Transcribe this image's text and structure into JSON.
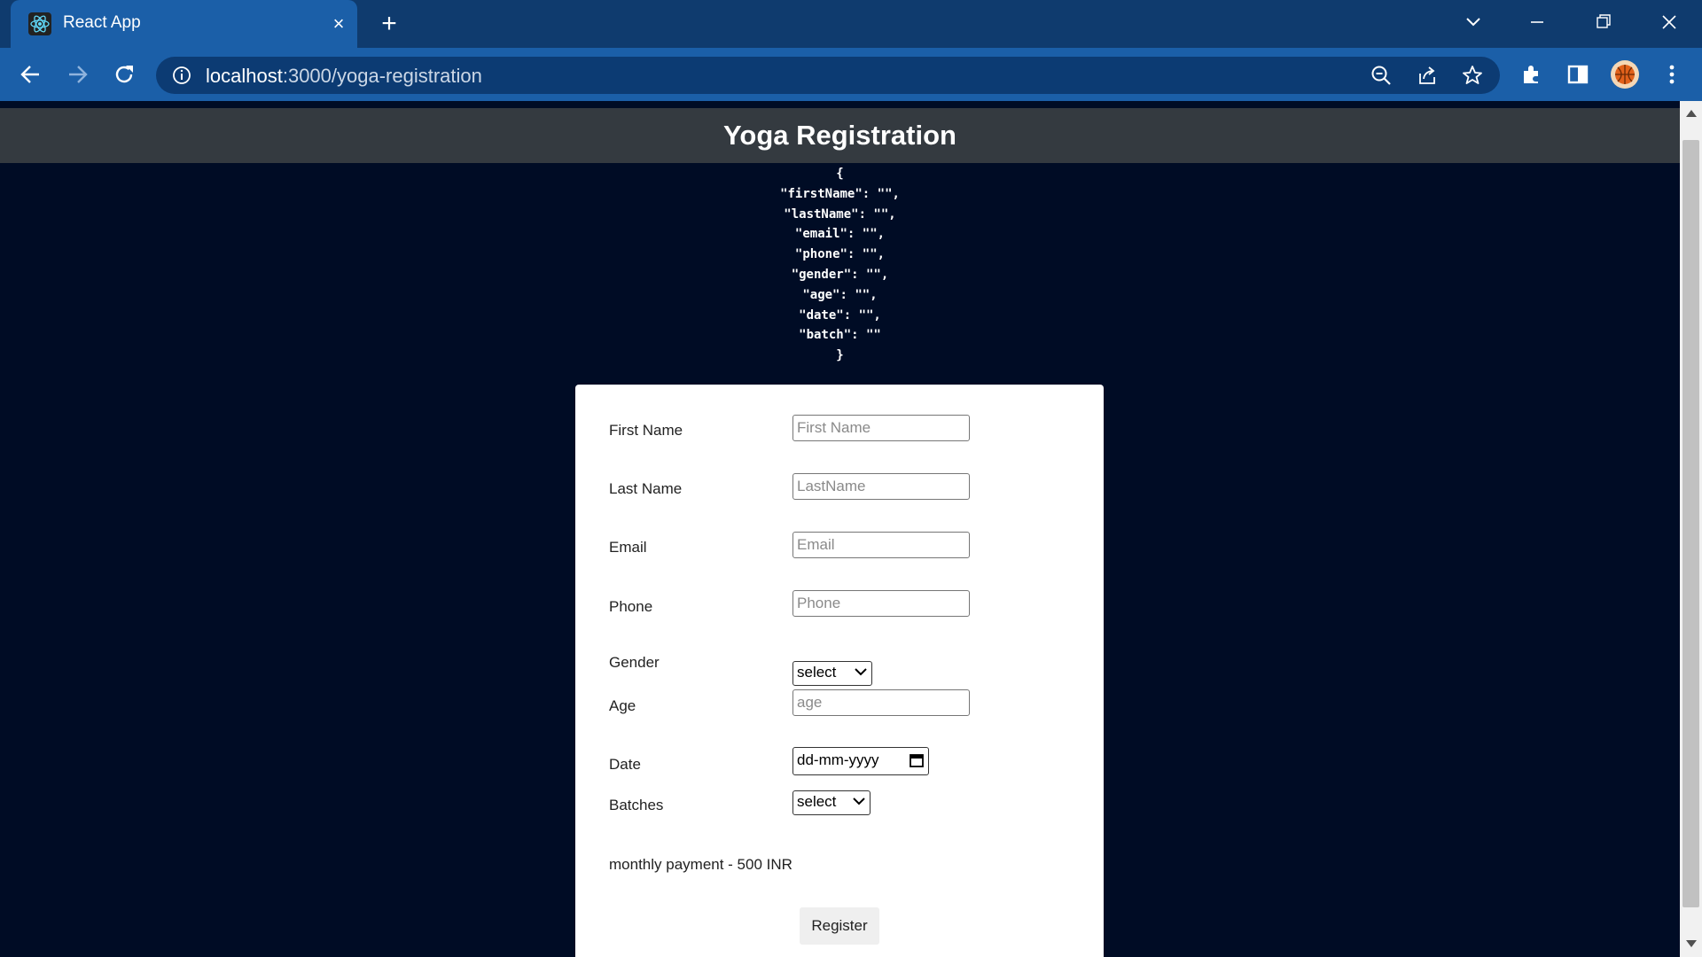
{
  "browser": {
    "tab_title": "React App",
    "tab_close": "×",
    "new_tab": "+",
    "url_host": "localhost",
    "url_path": ":3000/yoga-registration",
    "icons": {
      "favicon": "react-logo-icon",
      "back": "back-arrow-icon",
      "forward": "forward-arrow-icon",
      "reload": "reload-icon",
      "info": "info-icon",
      "zoom": "zoom-out-icon",
      "share": "share-icon",
      "bookmark": "star-icon",
      "extensions": "puzzle-icon",
      "sidepanel": "side-panel-icon",
      "profile": "avatar",
      "menu": "kebab-menu-icon",
      "tab_search": "chevron-down-icon",
      "minimize": "minimize-icon",
      "restore": "restore-icon",
      "close": "close-icon"
    }
  },
  "page": {
    "title": "Yoga Registration",
    "json_dump": "{\n\"firstName\": \"\",\n\"lastName\": \"\",\n\"email\": \"\",\n\"phone\": \"\",\n\"gender\": \"\",\n\"age\": \"\",\n\"date\": \"\",\n\"batch\": \"\"\n}"
  },
  "form": {
    "first_name_label": "First Name",
    "first_name_placeholder": "First Name",
    "last_name_label": "Last Name",
    "last_name_placeholder": "LastName",
    "email_label": "Email",
    "email_placeholder": "Email",
    "phone_label": "Phone",
    "phone_placeholder": "Phone",
    "gender_label": "Gender",
    "gender_value": "select",
    "age_label": "Age",
    "age_placeholder": "age",
    "date_label": "Date",
    "date_value": "dd-mm-yyyy",
    "batches_label": "Batches",
    "batches_value": "select",
    "payment_text": "monthly payment - 500 INR",
    "register_label": "Register"
  },
  "colors": {
    "page_bg": "#000c25",
    "header_bg": "#343a40",
    "chrome_tabstrip": "#0f3b6e",
    "chrome_toolbar": "#1b5fa8"
  }
}
